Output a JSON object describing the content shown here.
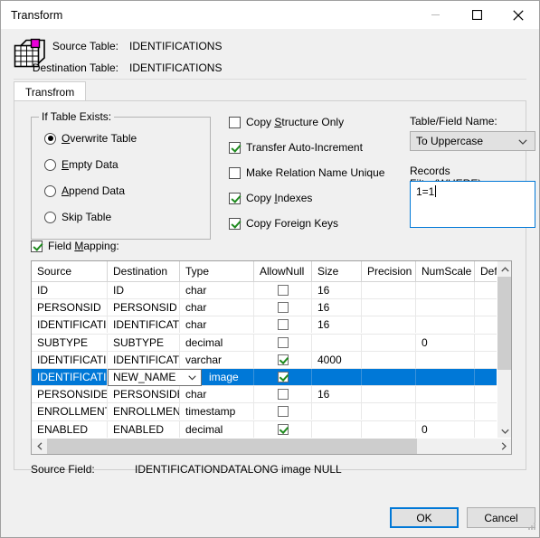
{
  "window": {
    "title": "Transform",
    "minimize_icon": "minimize-icon",
    "maximize_icon": "maximize-icon",
    "close_icon": "close-icon"
  },
  "header": {
    "icon": "table-transform-icon",
    "source_table_label": "Source Table:",
    "source_table_value": "IDENTIFICATIONS",
    "destination_table_label": "Destination Table:",
    "destination_table_value": "IDENTIFICATIONS"
  },
  "tabs": [
    {
      "label": "Transfrom",
      "selected": true
    }
  ],
  "if_table_exists": {
    "title": "If Table Exists:",
    "options": [
      {
        "label": "Overwrite Table",
        "accel": "O",
        "checked": true
      },
      {
        "label": "Empty Data",
        "accel": "E",
        "checked": false
      },
      {
        "label": "Append Data",
        "accel": "A",
        "checked": false
      },
      {
        "label": "Skip Table",
        "accel": "",
        "checked": false
      }
    ]
  },
  "options": [
    {
      "label": "Copy Structure Only",
      "accel": "S",
      "checked": false
    },
    {
      "label": "Transfer Auto-Increment",
      "accel": "",
      "checked": true
    },
    {
      "label": "Make Relation Name Unique",
      "accel": "",
      "checked": false
    },
    {
      "label": "Copy Indexes",
      "accel": "I",
      "checked": true
    },
    {
      "label": "Copy Foreign Keys",
      "accel": "",
      "checked": true
    }
  ],
  "right_panel": {
    "table_field_name_label": "Table/Field Name:",
    "table_field_name_value": "To Uppercase",
    "records_filter_label": "Records Filter(WHERE):",
    "records_filter_value": "1=1",
    "chevron_icon": "chevron-down-icon"
  },
  "field_mapping": {
    "label": "Field Mapping:",
    "accel": "M",
    "checked": true,
    "columns": [
      "Source",
      "Destination",
      "Type",
      "AllowNull",
      "Size",
      "Precision",
      "NumScale",
      "Default Val"
    ],
    "rows": [
      {
        "source": "ID",
        "destination": "ID",
        "type": "char",
        "allownull": false,
        "size": "16",
        "precision": "",
        "numscale": "",
        "default": "",
        "selected": false
      },
      {
        "source": "PERSONSID",
        "destination": "PERSONSID",
        "type": "char",
        "allownull": false,
        "size": "16",
        "precision": "",
        "numscale": "",
        "default": "",
        "selected": false
      },
      {
        "source": "IDENTIFICATIONTYPE",
        "destination": "IDENTIFICATIONTYPE",
        "type": "char",
        "allownull": false,
        "size": "16",
        "precision": "",
        "numscale": "",
        "default": "",
        "selected": false
      },
      {
        "source": "SUBTYPE",
        "destination": "SUBTYPE",
        "type": "decimal",
        "allownull": false,
        "size": "",
        "precision": "",
        "numscale": "0",
        "default": "",
        "selected": false
      },
      {
        "source": "IDENTIFICATIONDATA",
        "destination": "IDENTIFICATIONDATA",
        "type": "varchar",
        "allownull": true,
        "size": "4000",
        "precision": "",
        "numscale": "",
        "default": "",
        "selected": false
      },
      {
        "source": "IDENTIFICATIONDATALONG",
        "destination": "NEW_NAME",
        "type": "image",
        "allownull": true,
        "size": "",
        "precision": "",
        "numscale": "",
        "default": "",
        "selected": true,
        "editing": true
      },
      {
        "source": "PERSONSIDENROLLED",
        "destination": "PERSONSIDENROLLED",
        "type": "char",
        "allownull": false,
        "size": "16",
        "precision": "",
        "numscale": "",
        "default": "",
        "selected": false
      },
      {
        "source": "ENROLLMENTDATE",
        "destination": "ENROLLMENTDATE",
        "type": "timestamp",
        "allownull": false,
        "size": "",
        "precision": "",
        "numscale": "",
        "default": "",
        "selected": false
      },
      {
        "source": "ENABLED",
        "destination": "ENABLED",
        "type": "decimal",
        "allownull": true,
        "size": "",
        "precision": "",
        "numscale": "0",
        "default": "",
        "selected": false
      }
    ]
  },
  "source_field": {
    "label": "Source Field:",
    "value": "IDENTIFICATIONDATALONG image NULL"
  },
  "footer": {
    "ok_label": "OK",
    "cancel_label": "Cancel"
  }
}
